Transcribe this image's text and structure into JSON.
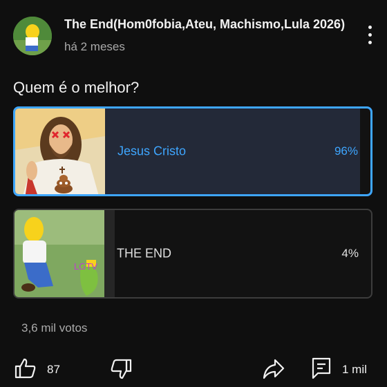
{
  "post": {
    "author": "The End(Hom0fobia,Ateu, Machismo,Lula 2026)",
    "time": "há 2 meses",
    "question": "Quem é o melhor?"
  },
  "poll": {
    "options": [
      {
        "label": "Jesus Cristo",
        "percent_text": "96%",
        "percent": 96,
        "selected": true,
        "image_overlay": ""
      },
      {
        "label": "THE END",
        "percent_text": "4%",
        "percent": 4,
        "selected": false,
        "image_overlay": "LGTV"
      }
    ],
    "votes": "3,6 mil votos"
  },
  "actions": {
    "like_count": "87",
    "comment_count": "1 mil"
  },
  "colors": {
    "accent": "#3ea6ff",
    "background": "#0f0f0f",
    "muted_text": "#aaaaaa"
  },
  "icons": [
    "avatar-image",
    "more-vert-icon",
    "thumbs-up-icon",
    "thumbs-down-icon",
    "share-icon",
    "comment-icon"
  ]
}
